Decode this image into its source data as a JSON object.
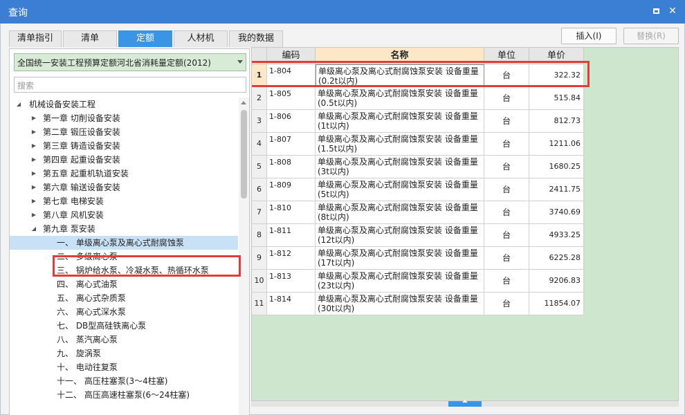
{
  "window": {
    "title": "查询"
  },
  "tabs": [
    {
      "label": "清单指引",
      "active": false
    },
    {
      "label": "清单",
      "active": false
    },
    {
      "label": "定额",
      "active": true
    },
    {
      "label": "人材机",
      "active": false
    },
    {
      "label": "我的数据",
      "active": false
    }
  ],
  "actions": {
    "insert_label": "插入(I)",
    "replace_label": "替换(R)"
  },
  "library": {
    "selected": "全国统一安装工程预算定额河北省消耗量定额(2012)"
  },
  "search": {
    "placeholder": "搜索"
  },
  "tree": [
    {
      "label": "机械设备安装工程",
      "level": 0,
      "expanded": true
    },
    {
      "label": "第一章 切削设备安装",
      "level": 1,
      "expanded": false
    },
    {
      "label": "第二章 锻压设备安装",
      "level": 1,
      "expanded": false
    },
    {
      "label": "第三章 铸造设备安装",
      "level": 1,
      "expanded": false
    },
    {
      "label": "第四章 起重设备安装",
      "level": 1,
      "expanded": false
    },
    {
      "label": "第五章 起重机轨道安装",
      "level": 1,
      "expanded": false
    },
    {
      "label": "第六章 输送设备安装",
      "level": 1,
      "expanded": false
    },
    {
      "label": "第七章 电梯安装",
      "level": 1,
      "expanded": false
    },
    {
      "label": "第八章 风机安装",
      "level": 1,
      "expanded": false
    },
    {
      "label": "第九章 泵安装",
      "level": 1,
      "expanded": true
    },
    {
      "label": "一、 单级离心泵及离心式耐腐蚀泵",
      "level": 2,
      "selected": true
    },
    {
      "label": "二、 多级离心泵",
      "level": 2
    },
    {
      "label": "三、 锅炉给水泵、冷凝水泵、热循环水泵",
      "level": 2
    },
    {
      "label": "四、 离心式油泵",
      "level": 2
    },
    {
      "label": "五、 离心式杂质泵",
      "level": 2
    },
    {
      "label": "六、 离心式深水泵",
      "level": 2
    },
    {
      "label": "七、 DB型高硅铁离心泵",
      "level": 2
    },
    {
      "label": "八、 蒸汽离心泵",
      "level": 2
    },
    {
      "label": "九、 旋涡泵",
      "level": 2
    },
    {
      "label": "十、 电动往复泵",
      "level": 2
    },
    {
      "label": "十一、 高压柱塞泵(3～4柱塞)",
      "level": 2
    },
    {
      "label": "十二、 高压高速柱塞泵(6～24柱塞)",
      "level": 2
    }
  ],
  "grid": {
    "columns": [
      "编码",
      "名称",
      "单位",
      "单价"
    ],
    "rows": [
      {
        "idx": "1",
        "code": "1-804",
        "name1": "单级离心泵及离心式耐腐蚀泵安装 设备重量",
        "name2": "(0.2t以内)",
        "unit": "台",
        "price": "322.32"
      },
      {
        "idx": "2",
        "code": "1-805",
        "name1": "单级离心泵及离心式耐腐蚀泵安装 设备重量",
        "name2": "(0.5t以内)",
        "unit": "台",
        "price": "515.84"
      },
      {
        "idx": "3",
        "code": "1-806",
        "name1": "单级离心泵及离心式耐腐蚀泵安装 设备重量",
        "name2": "(1t以内)",
        "unit": "台",
        "price": "812.73"
      },
      {
        "idx": "4",
        "code": "1-807",
        "name1": "单级离心泵及离心式耐腐蚀泵安装 设备重量",
        "name2": "(1.5t以内)",
        "unit": "台",
        "price": "1211.06"
      },
      {
        "idx": "5",
        "code": "1-808",
        "name1": "单级离心泵及离心式耐腐蚀泵安装 设备重量",
        "name2": "(3t以内)",
        "unit": "台",
        "price": "1680.25"
      },
      {
        "idx": "6",
        "code": "1-809",
        "name1": "单级离心泵及离心式耐腐蚀泵安装 设备重量",
        "name2": "(5t以内)",
        "unit": "台",
        "price": "2411.75"
      },
      {
        "idx": "7",
        "code": "1-810",
        "name1": "单级离心泵及离心式耐腐蚀泵安装 设备重量",
        "name2": "(8t以内)",
        "unit": "台",
        "price": "3740.69"
      },
      {
        "idx": "8",
        "code": "1-811",
        "name1": "单级离心泵及离心式耐腐蚀泵安装 设备重量",
        "name2": "(12t以内)",
        "unit": "台",
        "price": "4933.25"
      },
      {
        "idx": "9",
        "code": "1-812",
        "name1": "单级离心泵及离心式耐腐蚀泵安装 设备重量",
        "name2": "(17t以内)",
        "unit": "台",
        "price": "6225.28"
      },
      {
        "idx": "10",
        "code": "1-813",
        "name1": "单级离心泵及离心式耐腐蚀泵安装 设备重量",
        "name2": "(23t以内)",
        "unit": "台",
        "price": "9206.83"
      },
      {
        "idx": "11",
        "code": "1-814",
        "name1": "单级离心泵及离心式耐腐蚀泵安装 设备重量",
        "name2": "(30t以内)",
        "unit": "台",
        "price": "11854.07"
      }
    ]
  },
  "colors": {
    "titlebar": "#3b7fd4",
    "active_tab": "#3b95e6",
    "grid_background": "#cde6cd",
    "name_header": "#fde7c7",
    "tree_selected": "#c8e1f6",
    "highlight_box": "#e03c3c"
  },
  "icons": {
    "restore": "restore-icon",
    "close": "close-icon",
    "expand": "caret-right-icon",
    "collapse": "caret-down-icon"
  }
}
